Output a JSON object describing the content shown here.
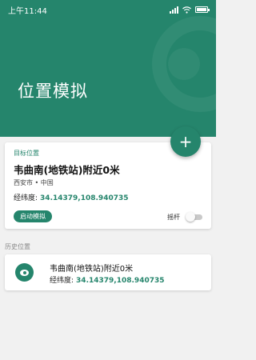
{
  "status_bar": {
    "time": "上午11:44"
  },
  "header": {
    "title": "位置模拟"
  },
  "fab": {
    "icon": "plus-icon",
    "glyph": "+"
  },
  "target": {
    "label": "目标位置",
    "name": "韦曲南(地铁站)附近0米",
    "city": "西安市 • 中国",
    "coords_label": "经纬度:",
    "coords_value": "34.14379,108.940735",
    "start_button": "启动模拟",
    "joystick_label": "摇杆",
    "joystick_on": false
  },
  "history": {
    "title": "历史位置",
    "items": [
      {
        "name": "韦曲南(地铁站)附近0米",
        "coords_label": "经纬度:",
        "coords_value": "34.14379,108.940735",
        "icon": "location-pin-icon"
      }
    ]
  },
  "colors": {
    "accent": "#25856c",
    "background": "#f1f1f1"
  }
}
